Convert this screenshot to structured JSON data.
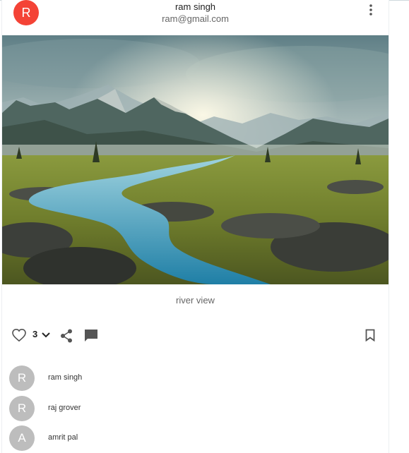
{
  "post": {
    "author": {
      "avatar_letter": "R",
      "name": "ram singh",
      "email": "ram@gmail.com",
      "avatar_color": "#f44336"
    },
    "menu_icon": "more-vert-icon",
    "image_alt": "river view landscape",
    "caption": "river view",
    "actions": {
      "like_icon": "heart-outline-icon",
      "like_count": "3",
      "expand_icon": "chevron-down-icon",
      "share_icon": "share-icon",
      "comment_icon": "comment-icon",
      "bookmark_icon": "bookmark-outline-icon"
    },
    "comments": [
      {
        "avatar_letter": "R",
        "name": "ram singh"
      },
      {
        "avatar_letter": "R",
        "name": "raj grover"
      },
      {
        "avatar_letter": "A",
        "name": "amrit pal"
      }
    ]
  }
}
